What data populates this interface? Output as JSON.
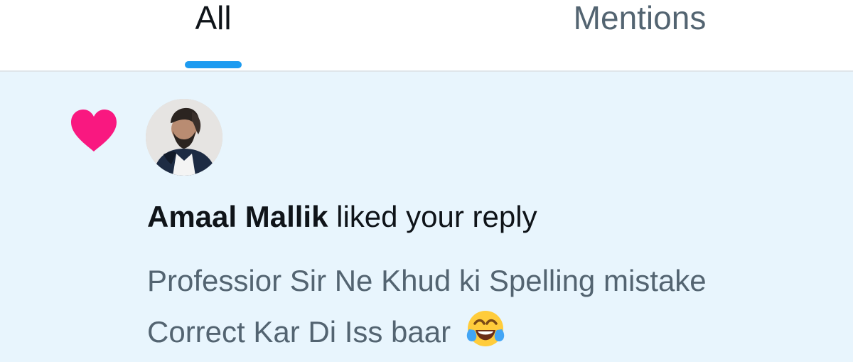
{
  "tabs": [
    {
      "label": "All",
      "selected": true
    },
    {
      "label": "Mentions",
      "selected": false
    }
  ],
  "notification": {
    "icon": "heart-icon",
    "icon_color": "#f91880",
    "actor_name": "Amaal Mallik",
    "action_text": "liked your reply",
    "reply_text": "Professior Sir Ne Khud ki Spelling mistake Correct Kar Di Iss baar",
    "reply_emoji": "face-with-tears-of-joy-icon",
    "background_color": "#e8f5fd"
  },
  "colors": {
    "accent": "#1d9bf0",
    "primary_text": "#0f1419",
    "secondary_text": "#536471"
  }
}
